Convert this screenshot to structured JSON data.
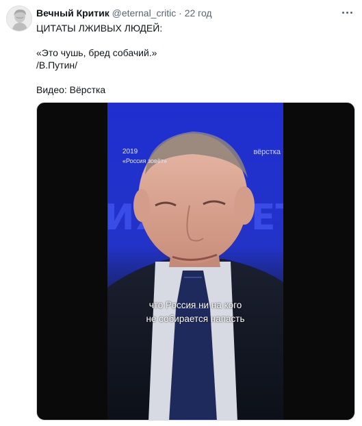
{
  "tweet": {
    "author_name": "Вечный Критик",
    "author_handle": "@eternal_critic",
    "separator": "·",
    "time": "22 год",
    "text_lines": [
      "ЦИТАТЫ ЛЖИВЫХ ЛЮДЕЙ:",
      "",
      "«Это чушь, бред собачий.»",
      "/В.Путин/",
      "",
      "Видео: Вёрстка"
    ]
  },
  "video": {
    "overlay_year": "2019",
    "overlay_event": "«Россия зовёт»",
    "overlay_brand": "вёрстка",
    "subtitle_line1": "что Россия ни на кого",
    "subtitle_line2": "не собирается напасть"
  },
  "icons": {
    "more": "more-horizontal-icon",
    "avatar": "avatar-sculpture"
  }
}
